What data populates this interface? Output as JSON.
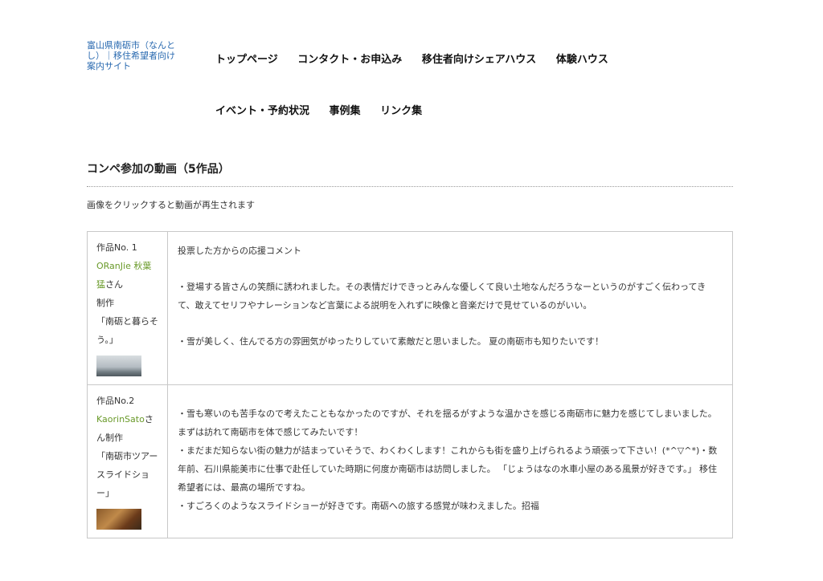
{
  "site": {
    "title": "富山県南砺市（なんとし）｜移住希望者向け案内サイト"
  },
  "nav": {
    "row1": [
      "トップページ",
      "コンタクト・お申込み",
      "移住者向けシェアハウス",
      "体験ハウス"
    ],
    "row2": [
      "イベント・予約状況",
      "事例集",
      "リンク集"
    ]
  },
  "main": {
    "section_title": "コンペ参加の動画（5作品）",
    "notice": "画像をクリックすると動画が再生されます",
    "works": [
      {
        "number": "作品No. 1",
        "author": "ORanJie 秋葉 猛",
        "suffix": "さん",
        "made_by": "制作",
        "title": "「南砺と暮らそう。」",
        "comments": [
          "投票した方からの応援コメント",
          "",
          "・登場する皆さんの笑顔に誘われました。その表情だけできっとみんな優しくて良い土地なんだろうなーというのがすごく伝わってきて、敢えてセリフやナレーションなど言葉による説明を入れずに映像と音楽だけで見せているのがいい。",
          "",
          "・雪が美しく、住んでる方の雰囲気がゆったりしていて素敵だと思いました。 夏の南砺市も知りたいです！"
        ]
      },
      {
        "number": "作品No.2",
        "author": "KaorinSato",
        "suffix": "さん",
        "made_by": "制作",
        "title": "「南砺市ツアースライドショー」",
        "comments": [
          "・雪も寒いのも苦手なので考えたこともなかったのですが、それを揺るがすような温かさを感じる南砺市に魅力を感じてしまいました。 まずは訪れて南砺市を体で感じてみたいです！",
          "・まだまだ知らない街の魅力が詰まっていそうで、わくわくします！これからも街を盛り上げられるよう頑張って下さい！(*^▽^*)・数年前、石川県能美市に仕事で赴任していた時期に何度か南砺市は訪問しました。 「じょうはなの水車小屋のある風景が好きです。」 移住希望者には、最高の場所ですね。",
          "・すごろくのようなスライドショーが好きです。南砺への旅する感覚が味わえました。招福"
        ]
      }
    ]
  }
}
